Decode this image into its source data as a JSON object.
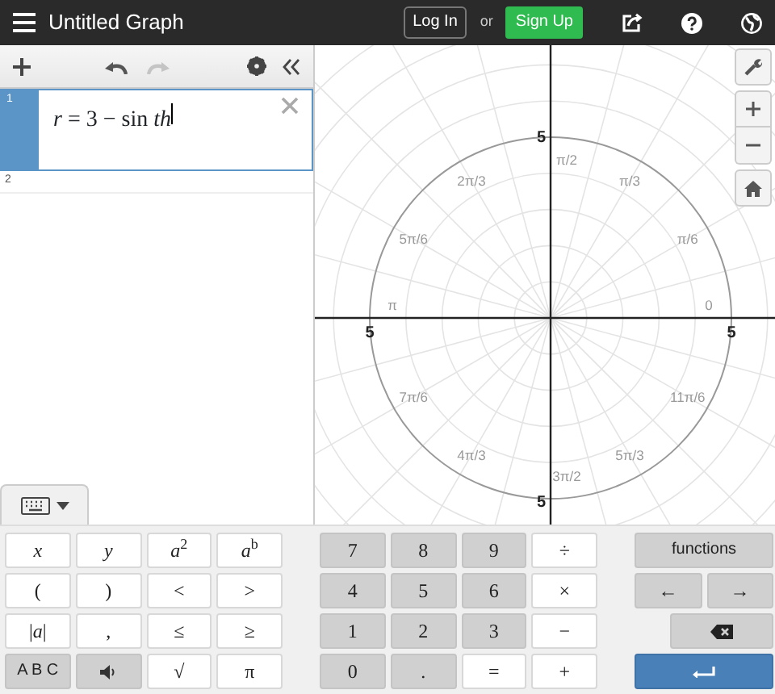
{
  "header": {
    "title": "Untitled Graph",
    "login": "Log In",
    "or": "or",
    "signup": "Sign Up"
  },
  "toolbar": {
    "undo": {
      "disabled": false
    },
    "redo": {
      "disabled": true
    }
  },
  "expressions": [
    {
      "number": "1",
      "text": "*r* = 3 − sin *th*",
      "selected": true
    },
    {
      "number": "2",
      "selected": false
    }
  ],
  "graph": {
    "angle_labels": [
      "0",
      "π/6",
      "π/3",
      "π/2",
      "2π/3",
      "5π/6",
      "π",
      "7π/6",
      "4π/3",
      "3π/2",
      "5π/3",
      "11π/6"
    ],
    "axis_labels": [
      "5",
      "5",
      "5",
      "5"
    ]
  },
  "keypad": {
    "open": true,
    "left": [
      {
        "label": "*x*",
        "kind": "symbol"
      },
      {
        "label": "*y*",
        "kind": "symbol"
      },
      {
        "label": "*a*$^{2}$",
        "kind": "symbol"
      },
      {
        "label": "*a*$^{b}$",
        "kind": "symbol"
      },
      {
        "label": "(",
        "kind": "symbol"
      },
      {
        "label": ")",
        "kind": "symbol"
      },
      {
        "label": "<",
        "kind": "symbol"
      },
      {
        "label": ">",
        "kind": "symbol"
      },
      {
        "label": "|*a*|",
        "kind": "symbol"
      },
      {
        "label": ",",
        "kind": "symbol"
      },
      {
        "label": "≤",
        "kind": "symbol"
      },
      {
        "label": "≥",
        "kind": "symbol"
      },
      {
        "label": "A B C",
        "kind": "word"
      },
      {
        "kind": "speaker"
      },
      {
        "label": "√",
        "kind": "symbol"
      },
      {
        "label": "π",
        "kind": "symbol"
      }
    ],
    "middle": [
      {
        "label": "7",
        "kind": "digit"
      },
      {
        "label": "8",
        "kind": "digit"
      },
      {
        "label": "9",
        "kind": "digit"
      },
      {
        "label": "÷",
        "kind": "symbol"
      },
      {
        "label": "4",
        "kind": "digit"
      },
      {
        "label": "5",
        "kind": "digit"
      },
      {
        "label": "6",
        "kind": "digit"
      },
      {
        "label": "×",
        "kind": "symbol"
      },
      {
        "label": "1",
        "kind": "digit"
      },
      {
        "label": "2",
        "kind": "digit"
      },
      {
        "label": "3",
        "kind": "digit"
      },
      {
        "label": "−",
        "kind": "symbol"
      },
      {
        "label": "0",
        "kind": "digit"
      },
      {
        "label": ".",
        "kind": "digit"
      },
      {
        "label": "=",
        "kind": "symbol"
      },
      {
        "label": "+",
        "kind": "symbol"
      }
    ],
    "right": [
      {
        "label": "functions",
        "kind": "word"
      },
      {
        "label": "←",
        "kind": "nav"
      },
      {
        "label": "→",
        "kind": "nav"
      },
      {
        "kind": "backspace"
      },
      {
        "kind": "enter"
      }
    ]
  }
}
